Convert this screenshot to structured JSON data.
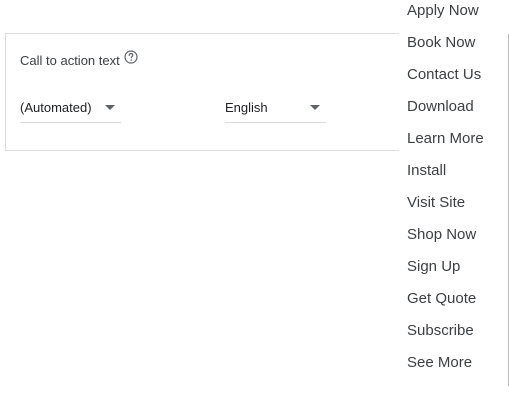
{
  "card": {
    "label": "Call to action text",
    "cta_select": {
      "value": "(Automated)"
    },
    "language_select": {
      "value": "English"
    }
  },
  "menu": {
    "items": [
      "Apply Now",
      "Book Now",
      "Contact Us",
      "Download",
      "Learn More",
      "Install",
      "Visit Site",
      "Shop Now",
      "Sign Up",
      "Get Quote",
      "Subscribe",
      "See More"
    ]
  },
  "colors": {
    "text": "#3c4043",
    "border": "#dadce0",
    "caret": "#5f6368"
  },
  "icons": {
    "help": "help-circle-icon",
    "caret": "caret-down-icon"
  }
}
